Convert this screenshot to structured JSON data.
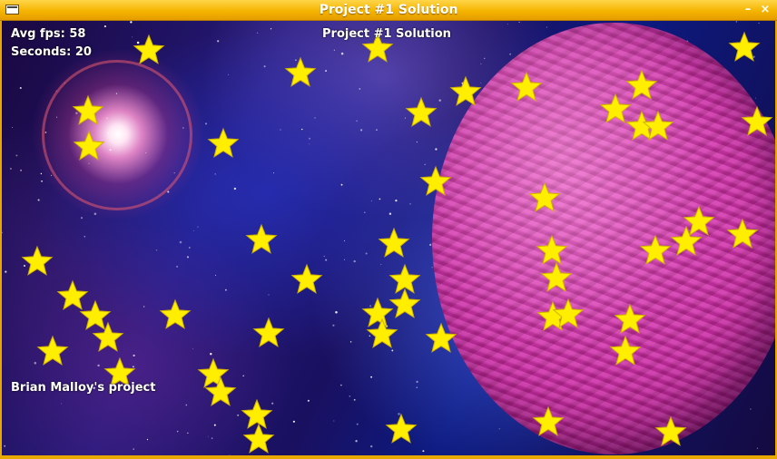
{
  "window": {
    "title": "Project #1 Solution",
    "minimize_glyph": "–",
    "close_glyph": "×"
  },
  "hud": {
    "fps_text": "Avg fps: 58",
    "seconds_text": "Seconds: 20",
    "title_text": "Project #1 Solution",
    "credit_text": "Brian Malloy's project"
  },
  "colors": {
    "titlebar": "#f5b400",
    "star_fill": "#ffee00",
    "star_outline": "#d0b000",
    "planet": "#d044b0"
  },
  "icons": {
    "window_menu": "window-menu-icon",
    "minimize": "minimize-icon",
    "close": "close-icon",
    "sprite": "star-icon"
  }
}
